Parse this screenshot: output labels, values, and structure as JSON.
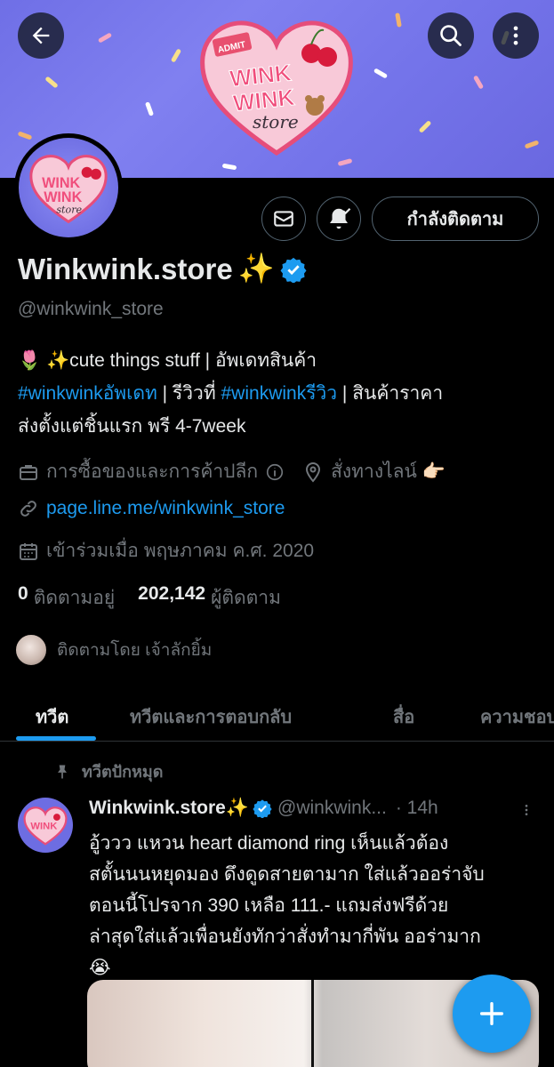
{
  "header": {
    "back_icon": "arrow-left-icon",
    "search_icon": "search-icon",
    "more_icon": "more-vertical-icon",
    "logo_text_1": "WINK",
    "logo_text_2": "WINK",
    "logo_text_3": "store",
    "logo_ticket": "ADMIT"
  },
  "profile": {
    "display_name": "Winkwink.store",
    "name_emoji": "✨",
    "handle": "@winkwink_store",
    "follow_button": "กำลังติดตาม",
    "bio": {
      "line1": "🌷 ✨cute things stuff | อัพเดทสินค้า",
      "hashtag1": "#winkwinkอัพเดท",
      "mid": " | รีวิวที่ ",
      "hashtag2": "#winkwinkรีวิว",
      "tail": " | สินค้าราคา",
      "line3": "ส่งตั้งแต่ชิ้นแรก พรี 4-7week"
    },
    "category": "การซื้อของและการค้าปลีก",
    "location": "สั่งทางไลน์ 👉🏻",
    "website": "page.line.me/winkwink_store",
    "joined": "เข้าร่วมเมื่อ พฤษภาคม ค.ศ. 2020",
    "following_count": "0",
    "following_label": "ติดตามอยู่",
    "followers_count": "202,142",
    "followers_label": "ผู้ติดตาม",
    "followed_by": "ติดตามโดย เจ้าลักยิ้ม"
  },
  "tabs": [
    {
      "label": "ทวีต"
    },
    {
      "label": "ทวีตและการตอบกลับ"
    },
    {
      "label": "สื่อ"
    },
    {
      "label": "ความชอบ"
    }
  ],
  "tweet": {
    "pinned_label": "ทวีตปักหมุด",
    "name": "Winkwink.store✨",
    "handle": "@winkwink...",
    "time": "· 14h",
    "text_lines": [
      "อู้ววว แหวน heart diamond ring เห็นแล้วต้อง",
      "สตั้นนนหยุดมอง ดึงดูดสายตามาก ใส่แล้วออร่าจับ",
      "ตอนนี้โปรจาก 390 เหลือ 111.- แถมส่งฟรีด้วย",
      "ล่าสุดใส่แล้วเพื่อนยังทักว่าสั่งทำมากี่พัน ออร่ามาก",
      "😭"
    ]
  },
  "colors": {
    "accent": "#1d9bf0",
    "background": "#000000",
    "muted": "#71767b",
    "banner": "#7474ea"
  }
}
